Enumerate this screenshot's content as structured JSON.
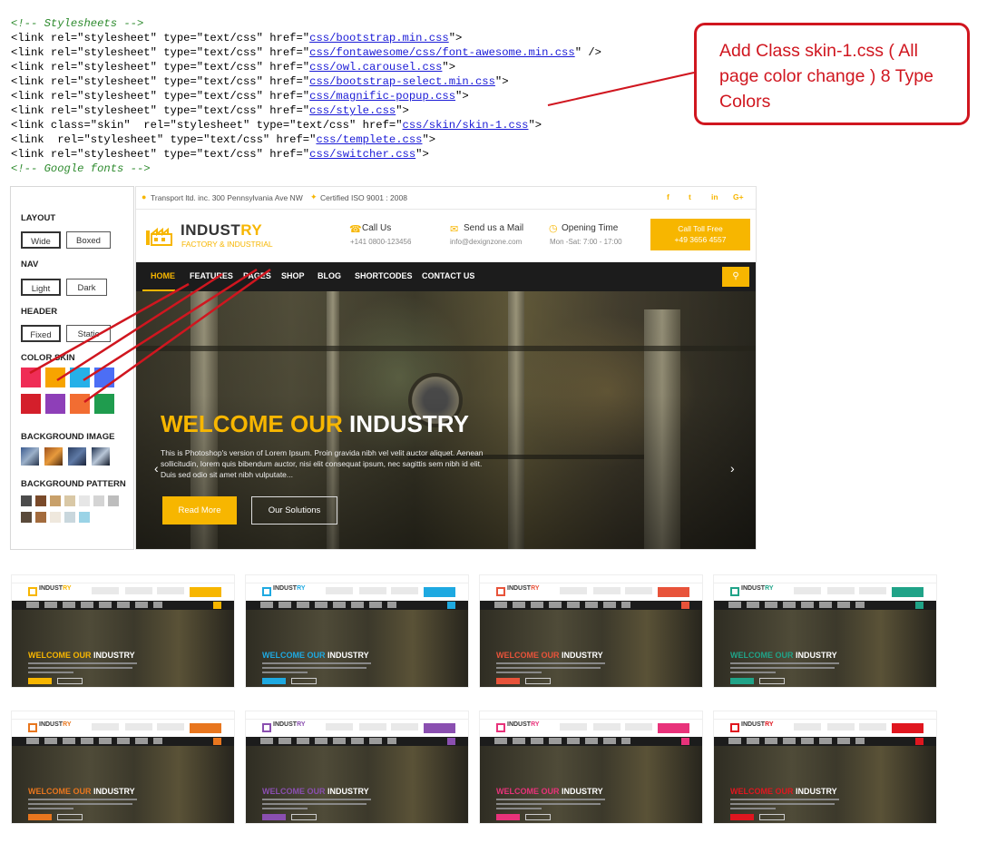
{
  "code": {
    "comment_top": "<!-- Stylesheets -->",
    "comment_bottom": "<!-- Google fonts -->",
    "lines": [
      {
        "pre": "<link rel=\"stylesheet\" type=\"text/css\" href=\"",
        "href": "css/bootstrap.min.css",
        "post": "\">"
      },
      {
        "pre": "<link rel=\"stylesheet\" type=\"text/css\" href=\"",
        "href": "css/fontawesome/css/font-awesome.min.css",
        "post": "\" />"
      },
      {
        "pre": "<link rel=\"stylesheet\" type=\"text/css\" href=\"",
        "href": "css/owl.carousel.css",
        "post": "\">"
      },
      {
        "pre": "<link rel=\"stylesheet\" type=\"text/css\" href=\"",
        "href": "css/bootstrap-select.min.css",
        "post": "\">"
      },
      {
        "pre": "<link rel=\"stylesheet\" type=\"text/css\" href=\"",
        "href": "css/magnific-popup.css",
        "post": "\">"
      },
      {
        "pre": "<link rel=\"stylesheet\" type=\"text/css\" href=\"",
        "href": "css/style.css",
        "post": "\">"
      },
      {
        "pre": "<link class=\"skin\"  rel=\"stylesheet\" type=\"text/css\" href=\"",
        "href": "css/skin/skin-1.css",
        "post": "\">"
      },
      {
        "pre": "<link  rel=\"stylesheet\" type=\"text/css\" href=\"",
        "href": "css/templete.css",
        "post": "\">"
      },
      {
        "pre": "<link rel=\"stylesheet\" type=\"text/css\" href=\"",
        "href": "css/switcher.css",
        "post": "\">"
      }
    ]
  },
  "callout": {
    "text": "Add Class skin-1.css ( All page color change ) 8 Type Colors"
  },
  "switcher": {
    "layout_heading": "LAYOUT",
    "layout_options": [
      "Wide",
      "Boxed"
    ],
    "nav_heading": "NAV",
    "nav_options": [
      "Light",
      "Dark"
    ],
    "header_heading": "HEADER",
    "header_options": [
      "Fixed",
      "Static"
    ],
    "color_skin_heading": "COLOR SKIN",
    "skin_colors": [
      "#ef2d56",
      "#f7a400",
      "#26b0e8",
      "#4c6ef5",
      "#d41f2b",
      "#8e3fb8",
      "#f26d32",
      "#1f9c4e"
    ],
    "background_image_heading": "BACKGROUND IMAGE",
    "background_pattern_heading": "BACKGROUND PATTERN"
  },
  "site": {
    "address": "Transport ltd. inc. 300 Pennsylvania Ave NW",
    "certified": "Certified ISO 9001 : 2008",
    "brand_main": "INDUST",
    "brand_accent": "RY",
    "brand_sub": "FACTORY & INDUSTRIAL",
    "call_label": "Call Us",
    "call_value": "+141 0800-123456",
    "mail_label": "Send us a Mail",
    "mail_value": "info@dexignzone.com",
    "time_label": "Opening Time",
    "time_value": "Mon -Sat: 7:00 - 17:00",
    "cta_line1": "Call Toll Free",
    "cta_line2": "+49 3656 4557",
    "nav": [
      "HOME",
      "FEATURES",
      "PAGES",
      "SHOP",
      "BLOG",
      "SHORTCODES",
      "CONTACT US"
    ],
    "hero_title_accent": "WELCOME OUR",
    "hero_title_rest": "INDUSTRY",
    "hero_text_1": "This is Photoshop's version of Lorem Ipsum. Proin gravida nibh vel velit auctor aliquet. Aenean",
    "hero_text_2": "sollicitudin, lorem quis bibendum auctor, nisi elit consequat ipsum, nec sagittis sem nibh id elit.",
    "hero_text_3": "Duis sed odio sit amet nibh vulputate...",
    "btn_read": "Read More",
    "btn_solutions": "Our Solutions",
    "accent": "#f7b600"
  },
  "thumbnails": {
    "title_accent": "WELCOME OUR",
    "title_rest": "INDUSTRY",
    "brand_main": "INDUST",
    "brand_accent": "RY",
    "colors": [
      "#f7b600",
      "#1ea9e1",
      "#e8533a",
      "#20a388",
      "#e8761e",
      "#8a4fb0",
      "#e8327a",
      "#e0161f"
    ]
  },
  "colors": {
    "annotation_red": "#d0161f",
    "nav_bg": "#1c1c1c"
  }
}
